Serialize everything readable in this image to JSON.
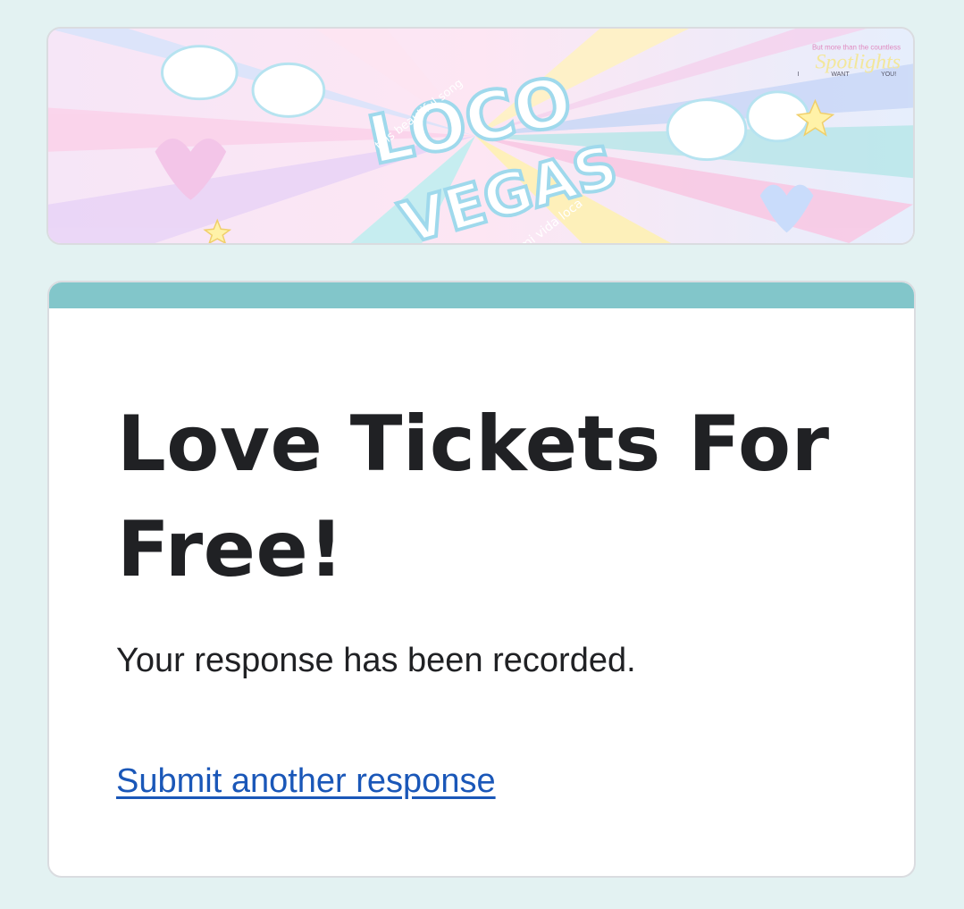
{
  "banner": {
    "logo_text": "LOCO",
    "logo_text_2": "VEGAS",
    "tag_left": "this beautiful song",
    "tag_bottom": "mi vida loca",
    "corner_top": "But more than the countless",
    "corner_main": "Spotlights",
    "corner_words": [
      "I",
      "WANT",
      "YOU!"
    ]
  },
  "form": {
    "title": "Love Tickets For Free!",
    "confirmation": "Your response has been recorded.",
    "another_link": "Submit another response"
  },
  "colors": {
    "background": "#e3f2f2",
    "accent": "#82c6ca",
    "link": "#1a57b8"
  }
}
